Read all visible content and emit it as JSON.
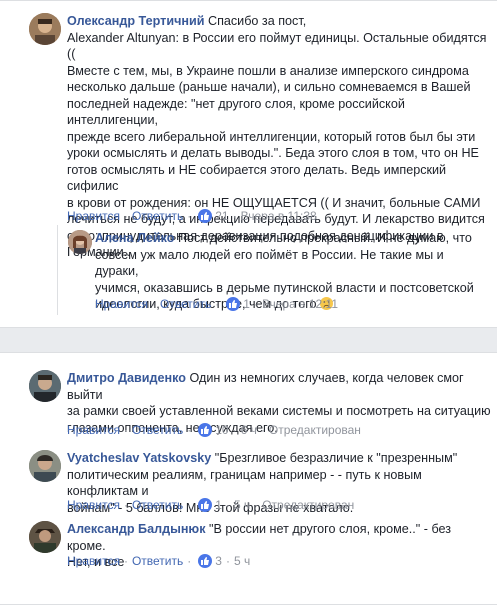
{
  "c1": {
    "author": "Олександр Тертичний",
    "lines": [
      "Спасибо за пост,",
      "Alexander Altunyan: в России его поймут единицы. Остальные обидятся ((",
      "Вместе с тем, мы, в Украине пошли в анализе имперского синдрома",
      "несколько дальше (раньше начали), и сильно сомневаемся в Вашей",
      "последней надежде: \"нет другого слоя, кроме российской интеллигенции,",
      "прежде всего либеральной интеллигенции, который готов был бы эти",
      "уроки осмыслять и делать выводы.\". Беда этого слоя в том, что он НЕ",
      "готов осмыслять и НЕ собирается этого делать. Ведь имперский сифилис",
      "в крови от рождения: он НЕ ОЩУЩАЕТСЯ (( И значит, больные САМИ",
      "лечиться не будут, а инфекцию передавать будут. И лекарство видится",
      "одно: принудительная деравизация подобная денацификации в",
      "Германии.."
    ],
    "like": "Нравится",
    "reply": "Ответить",
    "likes_count": "21",
    "time": "Вчера в 11:38"
  },
  "c2": {
    "author": "Алена Лейко",
    "lines": [
      "Пост действительно прекрасный. И не думаю, что",
      "совсем уж мало людей его поймёт в России. Не такие мы и дураки,",
      "учимся, оказавшись в дерьме путинской власти и постсоветской",
      "идеологии, куда быстрее, чем до того"
    ],
    "like": "Нравится",
    "reply": "Ответить",
    "likes_count": "1",
    "time": "Вчера в 12:11"
  },
  "c3": {
    "author": "Дмитро Давиденко",
    "lines": [
      "Один из немногих случаев, когда человек смог выйти",
      "за рамки своей устaвленной веками системы и посмотреть на ситуацию",
      "глазами оппонента, не осуждая его."
    ],
    "like": "Нравится",
    "reply": "Ответить",
    "likes_count": "10",
    "time": "6 ч",
    "edited": "Отредактирован"
  },
  "c4": {
    "author": "Vyatcheslav Yatskovsky",
    "lines": [
      "\"Брезгливое безразличие к \"презренным\"",
      "политическим реалиям, границам например - - путь к новым конфликтам и",
      "войнам\" - 5 баллов! Мне этой фразы не хватало."
    ],
    "like": "Нравится",
    "reply": "Ответить",
    "likes_count": "1",
    "time": "5 ч",
    "edited": "Отредактирован"
  },
  "c5": {
    "author": "Александр Балдынюк",
    "lines": [
      "\"В россии нет другого слоя, кроме..\" - без кроме.",
      "Нет, и все"
    ],
    "like": "Нравится",
    "reply": "Ответить",
    "likes_count": "3",
    "time": "5 ч"
  },
  "colors": {
    "link": "#385898",
    "action": "#4267b2",
    "meta": "#90949c",
    "like_badge": "#4a76e8"
  }
}
